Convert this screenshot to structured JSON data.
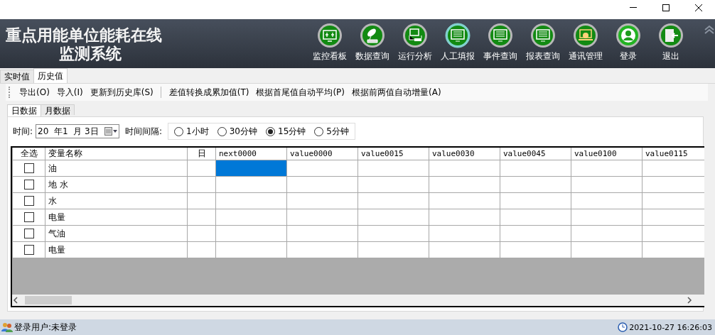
{
  "header": {
    "title_line1": "重点用能单位能耗在线",
    "title_line2": "监测系统"
  },
  "nav": [
    {
      "label": "监控看板",
      "selected": false
    },
    {
      "label": "数据查询",
      "selected": false
    },
    {
      "label": "运行分析",
      "selected": false
    },
    {
      "label": "人工填报",
      "selected": true
    },
    {
      "label": "事件查询",
      "selected": false
    },
    {
      "label": "报表查询",
      "selected": false
    },
    {
      "label": "通讯管理",
      "selected": false
    },
    {
      "label": "登录",
      "selected": false
    },
    {
      "label": "退出",
      "selected": false
    }
  ],
  "tabs": [
    {
      "label": "实时值",
      "selected": false
    },
    {
      "label": "历史值",
      "selected": true
    }
  ],
  "toolbar_groups": [
    [
      "导出(O)",
      "导入(I)",
      "更新到历史库(S)"
    ],
    [
      "差值转换成累加值(T)",
      "根据首尾值自动平均(P)",
      "根据前两值自动增量(A)"
    ]
  ],
  "subtabs": [
    {
      "label": "日数据",
      "selected": true
    },
    {
      "label": "月数据",
      "selected": false
    }
  ],
  "filter": {
    "time_label": "时间:",
    "date_value": "20  年1  月 3日",
    "interval_label": "时间间隔:",
    "intervals": [
      {
        "label": "1小时",
        "selected": false
      },
      {
        "label": "30分钟",
        "selected": false
      },
      {
        "label": "15分钟",
        "selected": true
      },
      {
        "label": "5分钟",
        "selected": false
      }
    ]
  },
  "table": {
    "columns": [
      "全选",
      "变量名称",
      "日",
      "next0000",
      "value0000",
      "value0015",
      "value0030",
      "value0045",
      "value0100",
      "value0115"
    ],
    "rows": [
      {
        "checked": false,
        "name": "油",
        "cells": [
          {
            "selected": true
          },
          {
            "selected": false
          },
          {
            "selected": false
          },
          {
            "selected": false
          },
          {
            "selected": false
          },
          {
            "selected": false
          },
          {
            "selected": false
          }
        ]
      },
      {
        "checked": false,
        "name": "地  水",
        "cells": [
          {
            "selected": false
          },
          {
            "selected": false
          },
          {
            "selected": false
          },
          {
            "selected": false
          },
          {
            "selected": false
          },
          {
            "selected": false
          },
          {
            "selected": false
          }
        ]
      },
      {
        "checked": false,
        "name": "水",
        "cells": [
          {
            "selected": false
          },
          {
            "selected": false
          },
          {
            "selected": false
          },
          {
            "selected": false
          },
          {
            "selected": false
          },
          {
            "selected": false
          },
          {
            "selected": false
          }
        ]
      },
      {
        "checked": false,
        "name": "电量",
        "cells": [
          {
            "selected": false
          },
          {
            "selected": false
          },
          {
            "selected": false
          },
          {
            "selected": false
          },
          {
            "selected": false
          },
          {
            "selected": false
          },
          {
            "selected": false
          }
        ]
      },
      {
        "checked": false,
        "name": "气油",
        "cells": [
          {
            "selected": false
          },
          {
            "selected": false
          },
          {
            "selected": false
          },
          {
            "selected": false
          },
          {
            "selected": false
          },
          {
            "selected": false
          },
          {
            "selected": false
          }
        ]
      },
      {
        "checked": false,
        "name": "电量",
        "cells": [
          {
            "selected": false
          },
          {
            "selected": false
          },
          {
            "selected": false
          },
          {
            "selected": false
          },
          {
            "selected": false
          },
          {
            "selected": false
          },
          {
            "selected": false
          }
        ]
      }
    ]
  },
  "status_bar": {
    "user": "登录用户:未登录",
    "datetime": "2021-10-27 16:26:03"
  }
}
